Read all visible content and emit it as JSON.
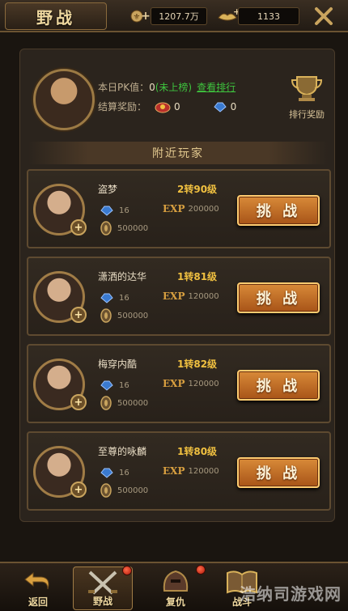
{
  "header": {
    "title": "野战",
    "gold_value": "1207.7万",
    "yuanbao_value": "1133"
  },
  "info": {
    "pk_label": "本日PK值：",
    "pk_value": "0",
    "pk_status": "(未上榜)",
    "view_rank_link": "查看排行",
    "reward_label": "结算奖励：",
    "reward_a_value": "0",
    "reward_b_value": "0",
    "rank_reward_label": "排行奖励"
  },
  "section_title": "附近玩家",
  "players": [
    {
      "name": "盗梦",
      "level": "2转90级",
      "gem": "16",
      "exp_tag": "EXP",
      "exp": "200000",
      "coin": "500000",
      "button": "挑 战"
    },
    {
      "name": "潇洒的达华",
      "level": "1转81级",
      "gem": "16",
      "exp_tag": "EXP",
      "exp": "120000",
      "coin": "500000",
      "button": "挑 战"
    },
    {
      "name": "梅穿内酷",
      "level": "1转82级",
      "gem": "16",
      "exp_tag": "EXP",
      "exp": "120000",
      "coin": "500000",
      "button": "挑 战"
    },
    {
      "name": "至尊的咏麟",
      "level": "1转80级",
      "gem": "16",
      "exp_tag": "EXP",
      "exp": "120000",
      "coin": "500000",
      "button": "挑 战"
    }
  ],
  "nav": {
    "back": "返回",
    "field": "野战",
    "revenge": "复仇",
    "battle": "战斗"
  },
  "watermark": "浩纳司游戏网",
  "colors": {
    "accent": "#f0c040",
    "button": "#c8702a",
    "link": "#3ec43e"
  }
}
